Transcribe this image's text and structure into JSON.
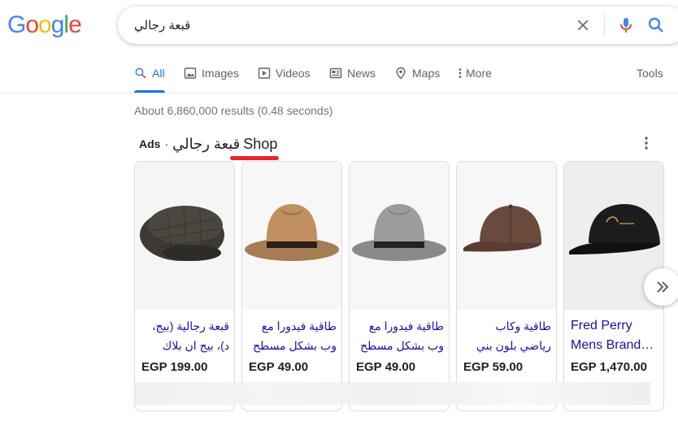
{
  "logo": {
    "letters": [
      "G",
      "o",
      "o",
      "g",
      "l",
      "e"
    ],
    "colors": [
      "#4285F4",
      "#EA4335",
      "#FBBC05",
      "#4285F4",
      "#34A853",
      "#EA4335"
    ]
  },
  "search": {
    "query": "قبعة رجالي"
  },
  "tabs": [
    {
      "label": "All",
      "icon": "search-icon",
      "active": true
    },
    {
      "label": "Images",
      "icon": "image-icon"
    },
    {
      "label": "Videos",
      "icon": "video-icon"
    },
    {
      "label": "News",
      "icon": "news-icon"
    },
    {
      "label": "Maps",
      "icon": "map-pin-icon"
    },
    {
      "label": "More",
      "icon": "more-vert-icon"
    }
  ],
  "tools_label": "Tools",
  "stats": "About 6,860,000 results (0.48 seconds)",
  "ads": {
    "label": "Ads",
    "dot": "·",
    "query": "قبعة رجالي",
    "shop": "Shop"
  },
  "products": [
    {
      "title": "قبعة رجالية (بيج، د)، بيج ان بلاك",
      "price": "EGP 199.00",
      "image": "flat-cap-icon"
    },
    {
      "title": "طاقية فيدورا مع وب بشكل مسطح",
      "price": "EGP 49.00",
      "image": "brown-fedora-icon"
    },
    {
      "title": "طاقية فيدورا مع وب بشكل مسطح",
      "price": "EGP 49.00",
      "image": "grey-fedora-icon"
    },
    {
      "title": "طاقية وكاب رياضي بلون بني",
      "price": "EGP 59.00",
      "image": "brown-cap-icon"
    },
    {
      "title": "Fred Perry Mens Brand…",
      "price": "EGP 1,470.00",
      "image": "black-cap-icon"
    }
  ],
  "accent": {
    "link": "#1a0dab",
    "blue": "#1a73e8",
    "underline_annotation": "#e8262c"
  }
}
